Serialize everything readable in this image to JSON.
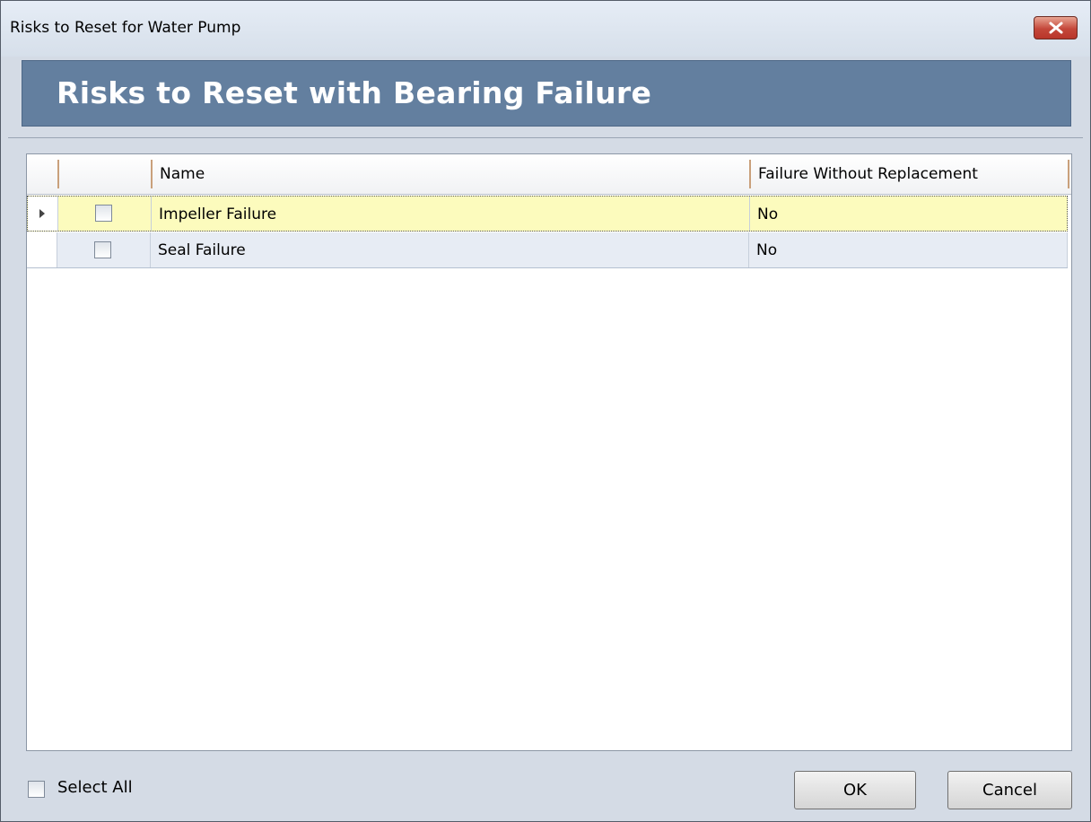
{
  "window": {
    "title": "Risks to Reset for Water Pump",
    "close_icon": "close-x-icon"
  },
  "banner": {
    "title": "Risks to Reset with Bearing Failure",
    "color": "#637f9f"
  },
  "grid": {
    "columns": [
      "",
      "Name",
      "Failure Without Replacement"
    ],
    "rows": [
      {
        "checked": false,
        "name": "Impeller Failure",
        "failure_without_replacement": "No",
        "selected": true
      },
      {
        "checked": false,
        "name": "Seal Failure",
        "failure_without_replacement": "No",
        "selected": false
      }
    ]
  },
  "footer": {
    "select_all_label": "Select All",
    "select_all_checked": false,
    "ok_label": "OK",
    "cancel_label": "Cancel"
  }
}
